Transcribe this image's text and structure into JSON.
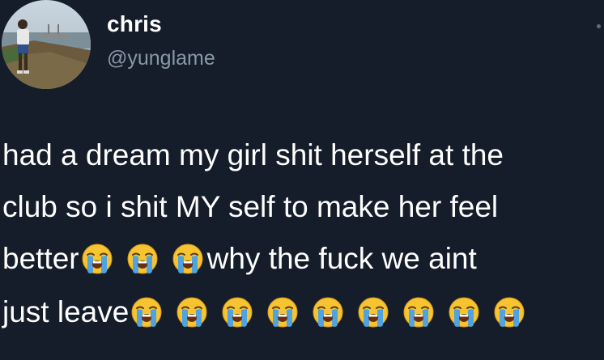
{
  "tweet": {
    "display_name": "chris",
    "handle": "@yunglame",
    "avatar_icon": "profile-photo",
    "lines": {
      "line1": "had a dream my girl shit herself at the",
      "line2": "club so i shit MY self to make her feel",
      "line3_a": "better",
      "line3_b": "why the fuck we aint",
      "line4_a": "just leave"
    },
    "emoji_name": "loudly-crying-face",
    "emoji_counts": {
      "line3": 3,
      "line4": 9
    }
  },
  "colors": {
    "background": "#151d2a",
    "text": "#ffffff",
    "handle": "#8899a6",
    "emoji_face": "#f6c431",
    "emoji_tears": "#4fa3e0"
  }
}
